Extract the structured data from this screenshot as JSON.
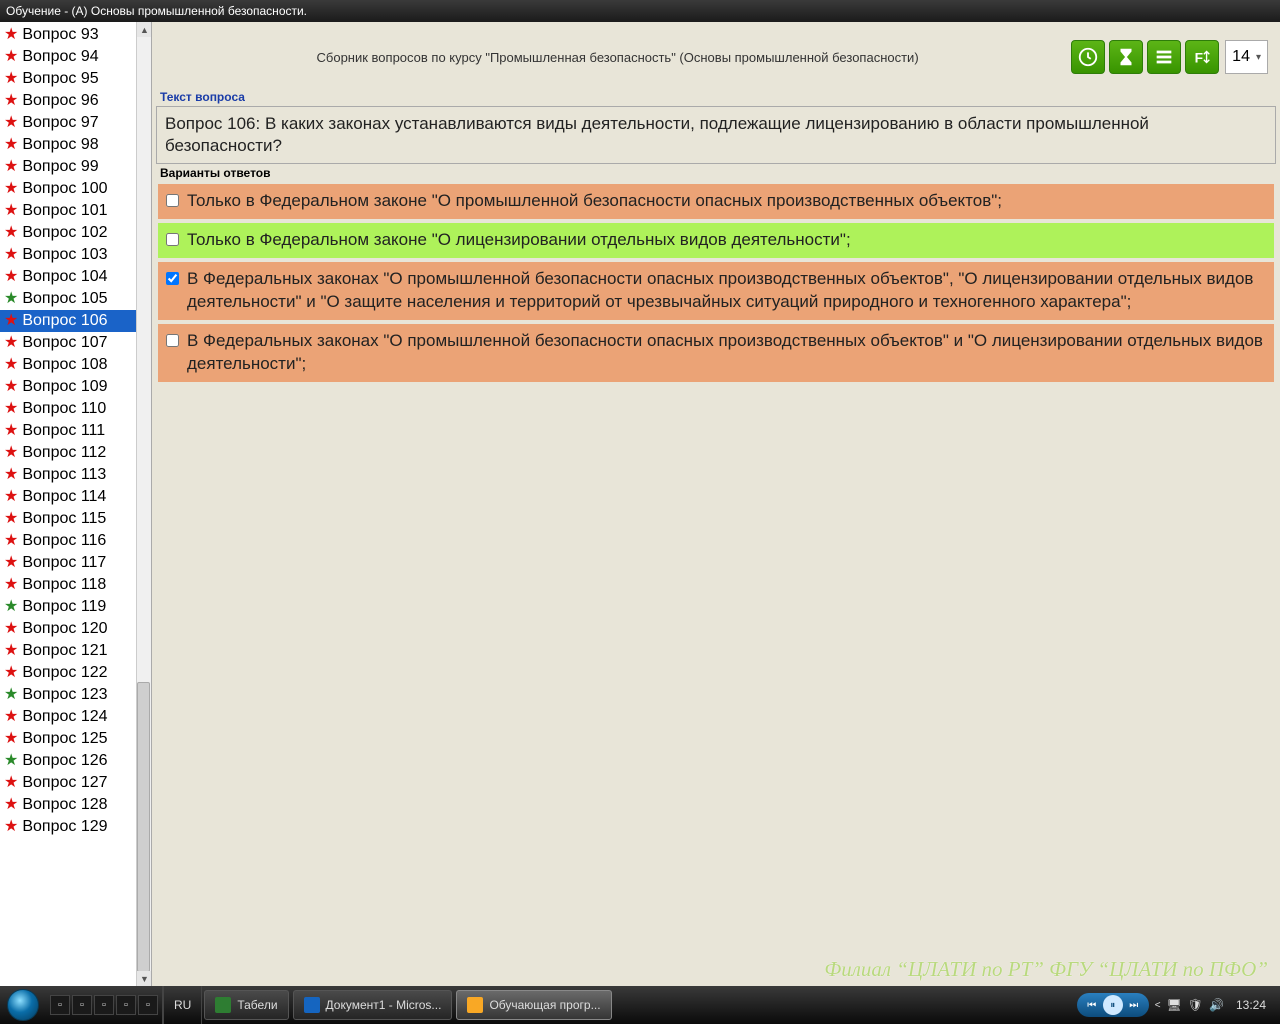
{
  "window_title": "Обучение - (А) Основы промышленной безопасности.",
  "header": {
    "course_title": "Сборник вопросов по курсу \"Промышленная безопасность\" (Основы промышленной безопасности)",
    "font_size": "14"
  },
  "toolbar_icons": [
    "clock-icon",
    "hourglass-icon",
    "list-icon",
    "font-icon"
  ],
  "question": {
    "label": "Текст вопроса",
    "text": "Вопрос 106: В каких законах устанавливаются виды деятельности, подлежащие лицензированию в области промышленной безопасности?"
  },
  "answers_label": "Варианты ответов",
  "answers": [
    {
      "text": "Только в Федеральном законе \"О промышленной безопасности опасных производственных объектов\";",
      "checked": false,
      "cls": "orange"
    },
    {
      "text": "Только в Федеральном законе \"О лицензировании отдельных видов деятельности\";",
      "checked": false,
      "cls": "green"
    },
    {
      "text": "В Федеральных законах \"О промышленной безопасности опасных производственных объектов\", \"О лицензировании отдельных видов деятельности\" и \"О защите населения и территорий от чрезвычайных ситуаций природного и техногенного характера\";",
      "checked": true,
      "cls": "orange"
    },
    {
      "text": "В Федеральных законах \"О промышленной безопасности опасных производственных объектов\" и \"О лицензировании отдельных видов деятельности\";",
      "checked": false,
      "cls": "orange"
    }
  ],
  "sidebar": {
    "items": [
      {
        "n": 93,
        "c": "red"
      },
      {
        "n": 94,
        "c": "red"
      },
      {
        "n": 95,
        "c": "red"
      },
      {
        "n": 96,
        "c": "red"
      },
      {
        "n": 97,
        "c": "red"
      },
      {
        "n": 98,
        "c": "red"
      },
      {
        "n": 99,
        "c": "red"
      },
      {
        "n": 100,
        "c": "red"
      },
      {
        "n": 101,
        "c": "red"
      },
      {
        "n": 102,
        "c": "red"
      },
      {
        "n": 103,
        "c": "red"
      },
      {
        "n": 104,
        "c": "red"
      },
      {
        "n": 105,
        "c": "green"
      },
      {
        "n": 106,
        "c": "red",
        "selected": true
      },
      {
        "n": 107,
        "c": "red"
      },
      {
        "n": 108,
        "c": "red"
      },
      {
        "n": 109,
        "c": "red"
      },
      {
        "n": 110,
        "c": "red"
      },
      {
        "n": 111,
        "c": "red"
      },
      {
        "n": 112,
        "c": "red"
      },
      {
        "n": 113,
        "c": "red"
      },
      {
        "n": 114,
        "c": "red"
      },
      {
        "n": 115,
        "c": "red"
      },
      {
        "n": 116,
        "c": "red"
      },
      {
        "n": 117,
        "c": "red"
      },
      {
        "n": 118,
        "c": "red"
      },
      {
        "n": 119,
        "c": "green"
      },
      {
        "n": 120,
        "c": "red"
      },
      {
        "n": 121,
        "c": "red"
      },
      {
        "n": 122,
        "c": "red"
      },
      {
        "n": 123,
        "c": "green"
      },
      {
        "n": 124,
        "c": "red"
      },
      {
        "n": 125,
        "c": "red"
      },
      {
        "n": 126,
        "c": "green"
      },
      {
        "n": 127,
        "c": "red"
      },
      {
        "n": 128,
        "c": "red"
      },
      {
        "n": 129,
        "c": "red"
      }
    ],
    "label_prefix": "Вопрос"
  },
  "watermark": "Филиал “ЦЛАТИ по РТ” ФГУ “ЦЛАТИ по ПФО”",
  "taskbar": {
    "lang": "RU",
    "tasks": [
      {
        "label": "Табели",
        "active": false,
        "icon_color": "#2e7d32"
      },
      {
        "label": "Документ1 - Micros...",
        "active": false,
        "icon_color": "#1565c0"
      },
      {
        "label": "Обучающая прогр...",
        "active": true,
        "icon_color": "#f9a825"
      }
    ],
    "clock": "13:24",
    "quick": [
      "desktop-icon",
      "ie-icon",
      "switch-icon",
      "wmp-icon",
      "app-icon"
    ]
  }
}
